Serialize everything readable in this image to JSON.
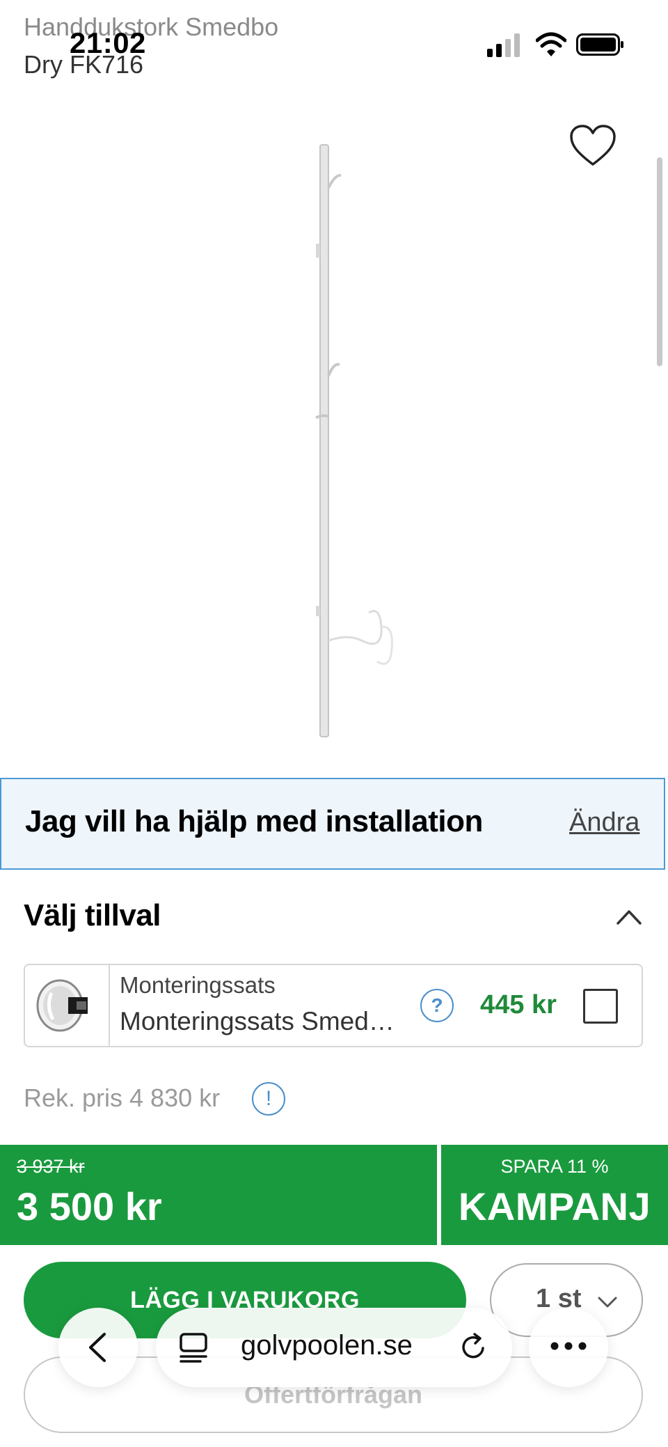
{
  "status_bar": {
    "time": "21:02"
  },
  "product": {
    "title_line1": "Handdukstork Smedbo",
    "title_line2": "Dry FK716"
  },
  "installation": {
    "text": "Jag vill ha hjälp med installation",
    "link": "Ändra"
  },
  "options": {
    "title": "Välj tillval",
    "items": [
      {
        "category": "Monteringssats",
        "name": "Monteringssats Smed…",
        "help": "?",
        "price": "445 kr"
      }
    ]
  },
  "recommended": {
    "label": "Rek. pris 4 830 kr",
    "info": "!"
  },
  "price": {
    "old": "3 937 kr",
    "current": "3 500 kr",
    "save_label": "SPARA 11 %",
    "campaign": "KAMPANJ"
  },
  "actions": {
    "add_to_cart": "LÄGG I VARUKORG",
    "quantity": "1 st",
    "offer": "Offertförfrågan"
  },
  "browser": {
    "url": "golvpoolen.se"
  },
  "colors": {
    "green": "#1a9a3e",
    "blue": "#4a9ad4",
    "price_green": "#1f8a3a"
  }
}
